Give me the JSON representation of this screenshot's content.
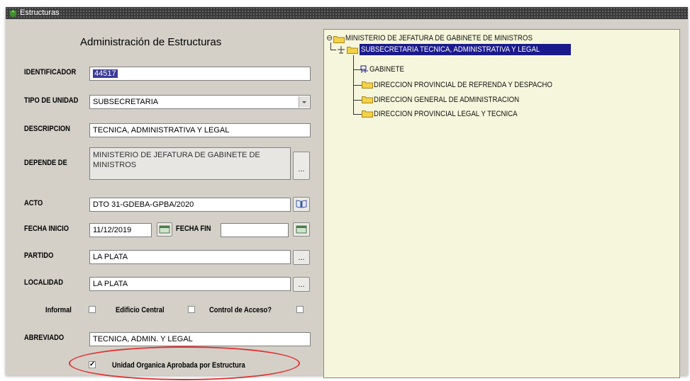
{
  "window": {
    "title": "Estructuras"
  },
  "form": {
    "title": "Administración de Estructuras",
    "identificador": {
      "label": "IDENTIFICADOR",
      "value": "44517"
    },
    "tipo_unidad": {
      "label": "TIPO DE UNIDAD",
      "value": "SUBSECRETARIA"
    },
    "descripcion": {
      "label": "DESCRIPCION",
      "value": "TECNICA, ADMINISTRATIVA Y LEGAL"
    },
    "depende_de": {
      "label": "DEPENDE DE",
      "value": "MINISTERIO DE JEFATURA DE GABINETE DE MINISTROS",
      "button": "..."
    },
    "acto": {
      "label": "ACTO",
      "value": "DTO 31-GDEBA-GPBA/2020"
    },
    "fecha_inicio": {
      "label": "FECHA INICIO",
      "value": "11/12/2019"
    },
    "fecha_fin": {
      "label": "FECHA FIN",
      "value": ""
    },
    "partido": {
      "label": "PARTIDO",
      "value": "LA PLATA",
      "button": "..."
    },
    "localidad": {
      "label": "LOCALIDAD",
      "value": "LA PLATA",
      "button": "..."
    },
    "checks": {
      "informal": {
        "label": "Informal",
        "checked": false
      },
      "edificio_central": {
        "label": "Edificio Central",
        "checked": false
      },
      "control_acceso": {
        "label": "Control de Acceso?",
        "checked": false
      }
    },
    "abreviado": {
      "label": "ABREVIADO",
      "value": "TECNICA, ADMIN. Y LEGAL"
    },
    "unidad_organica": {
      "label": "Unidad Organica Aprobada por Estructura",
      "checked": true,
      "check_glyph": "✓"
    }
  },
  "tree": {
    "root": {
      "label": "MINISTERIO DE JEFATURA DE GABINETE DE MINISTROS",
      "toggle": "⊖"
    },
    "selected": {
      "label": "SUBSECRETARIA TECNICA, ADMINISTRATIVA Y LEGAL"
    },
    "children": [
      {
        "label": "GABINETE"
      },
      {
        "label": "DIRECCION PROVINCIAL DE REFRENDA Y DESPACHO"
      },
      {
        "label": "DIRECCION GENERAL DE ADMINISTRACION"
      },
      {
        "label": "DIRECCION PROVINCIAL LEGAL Y TECNICA"
      }
    ]
  },
  "colors": {
    "window_bg": "#d4d0c8",
    "tree_bg": "#f6f6dc",
    "selection": "#1a1a8c",
    "highlight_ellipse": "#e03030"
  }
}
